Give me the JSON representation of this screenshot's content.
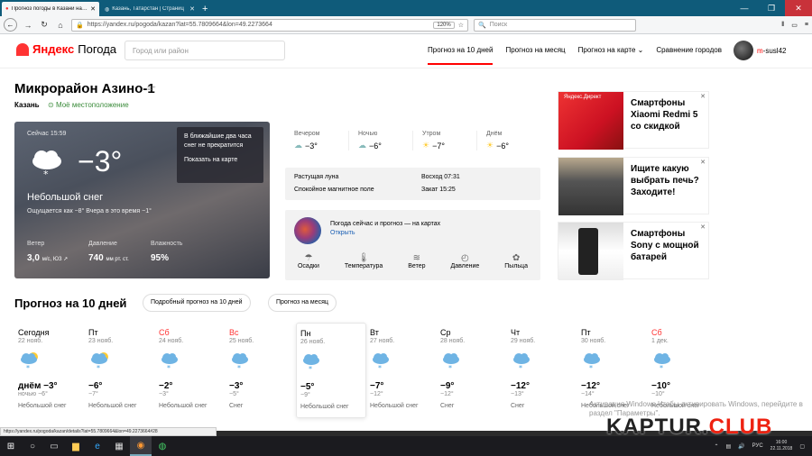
{
  "browser": {
    "tabs": [
      {
        "title": "Прогноз погоды в Казани на 10 д",
        "active": true
      },
      {
        "title": "Казань, Татарстан | Страниц",
        "active": false
      }
    ],
    "url": "https://yandex.ru/pogoda/kazan?lat=55.7809664&lon=49.2273664",
    "zoom": "120%",
    "search_placeholder": "Поиск"
  },
  "header": {
    "logo_ya": "Яндекс",
    "logo_pogoda": "Погода",
    "city_placeholder": "Город или район",
    "nav": [
      "Прогноз на 10 дней",
      "Прогноз на месяц",
      "Прогноз на карте ⌄",
      "Сравнение городов"
    ],
    "user_first": "m",
    "user_rest": "-susl42"
  },
  "location": {
    "title": "Микрорайон Азино-1",
    "city": "Казань",
    "my_location": "Моё местоположение"
  },
  "now": {
    "time": "Сейчас 15:59",
    "temp": "−3°",
    "condition": "Небольшой снег",
    "feels": "Ощущается как −8°   Вчера в это время −1°",
    "tip": "В ближайшие два часа снег не прекратится",
    "tip_link": "Показать на карте",
    "wind_label": "Ветер",
    "wind_value": "3,0",
    "wind_unit": "м/с, ЮЗ ↗",
    "pressure_label": "Давление",
    "pressure_value": "740",
    "pressure_unit": "мм рт. ст.",
    "humidity_label": "Влажность",
    "humidity_value": "95%"
  },
  "parts_of_day": [
    {
      "name": "Вечером",
      "temp": "−3°"
    },
    {
      "name": "Ночью",
      "temp": "−6°"
    },
    {
      "name": "Утром",
      "temp": "−7°"
    },
    {
      "name": "Днём",
      "temp": "−6°"
    }
  ],
  "astro": {
    "moon": "Растущая луна",
    "magnetic": "Спокойное магнитное поле",
    "sunrise": "Восход 07:31",
    "sunset": "Закат 15:25"
  },
  "maps": {
    "title": "Погода сейчас и прогноз — на картах",
    "link": "Открыть",
    "items": [
      "Осадки",
      "Температура",
      "Ветер",
      "Давление",
      "Пыльца"
    ]
  },
  "ads": [
    {
      "label": "Яндекс.Директ",
      "text": "Смартфоны Xiaomi Redmi 5 со скидкой"
    },
    {
      "label": "",
      "text": "Ищите какую выбрать печь? Заходите!"
    },
    {
      "label": "",
      "text": "Смартфоны Sony с мощной батарей"
    }
  ],
  "forecast": {
    "title": "Прогноз на 10 дней",
    "btn_detailed": "Подробный прогноз на 10 дней",
    "btn_month": "Прогноз на месяц",
    "days": [
      {
        "name": "Сегодня",
        "date": "22 нояб.",
        "high": "днём −3°",
        "low": "ночью −6°",
        "cond": "Небольшой снег",
        "weekend": false,
        "sun": true
      },
      {
        "name": "Пт",
        "date": "23 нояб.",
        "high": "−6°",
        "low": "−7°",
        "cond": "Небольшой снег",
        "weekend": false,
        "sun": true
      },
      {
        "name": "Сб",
        "date": "24 нояб.",
        "high": "−2°",
        "low": "−3°",
        "cond": "Небольшой снег",
        "weekend": true,
        "sun": false
      },
      {
        "name": "Вс",
        "date": "25 нояб.",
        "high": "−3°",
        "low": "−5°",
        "cond": "Снег",
        "weekend": true,
        "sun": false
      },
      {
        "name": "Пн",
        "date": "26 нояб.",
        "high": "−5°",
        "low": "−9°",
        "cond": "Небольшой снег",
        "weekend": false,
        "sun": false
      },
      {
        "name": "Вт",
        "date": "27 нояб.",
        "high": "−7°",
        "low": "−12°",
        "cond": "Небольшой снег",
        "weekend": false,
        "sun": false
      },
      {
        "name": "Ср",
        "date": "28 нояб.",
        "high": "−9°",
        "low": "−12°",
        "cond": "Снег",
        "weekend": false,
        "sun": false
      },
      {
        "name": "Чт",
        "date": "29 нояб.",
        "high": "−12°",
        "low": "−13°",
        "cond": "Снег",
        "weekend": false,
        "sun": false
      },
      {
        "name": "Пт",
        "date": "30 нояб.",
        "high": "−12°",
        "low": "−14°",
        "cond": "Небольшой снег",
        "weekend": false,
        "sun": false
      },
      {
        "name": "Сб",
        "date": "1 дек.",
        "high": "−10°",
        "low": "−10°",
        "cond": "Небольшой снег",
        "weekend": true,
        "sun": false
      }
    ]
  },
  "status_url": "https://yandex.ru/pogoda/kazan/details?lat=55.7809664&lon=49.2273664#28",
  "watermark": "Активация Windows\nЧтобы активировать Windows, перейдите в раздел \"Параметры\".",
  "kaptur_a": "KAPTUR.",
  "kaptur_b": "CLUB",
  "taskbar": {
    "lang": "РУС",
    "time": "16:00",
    "date": "22.11.2018"
  }
}
